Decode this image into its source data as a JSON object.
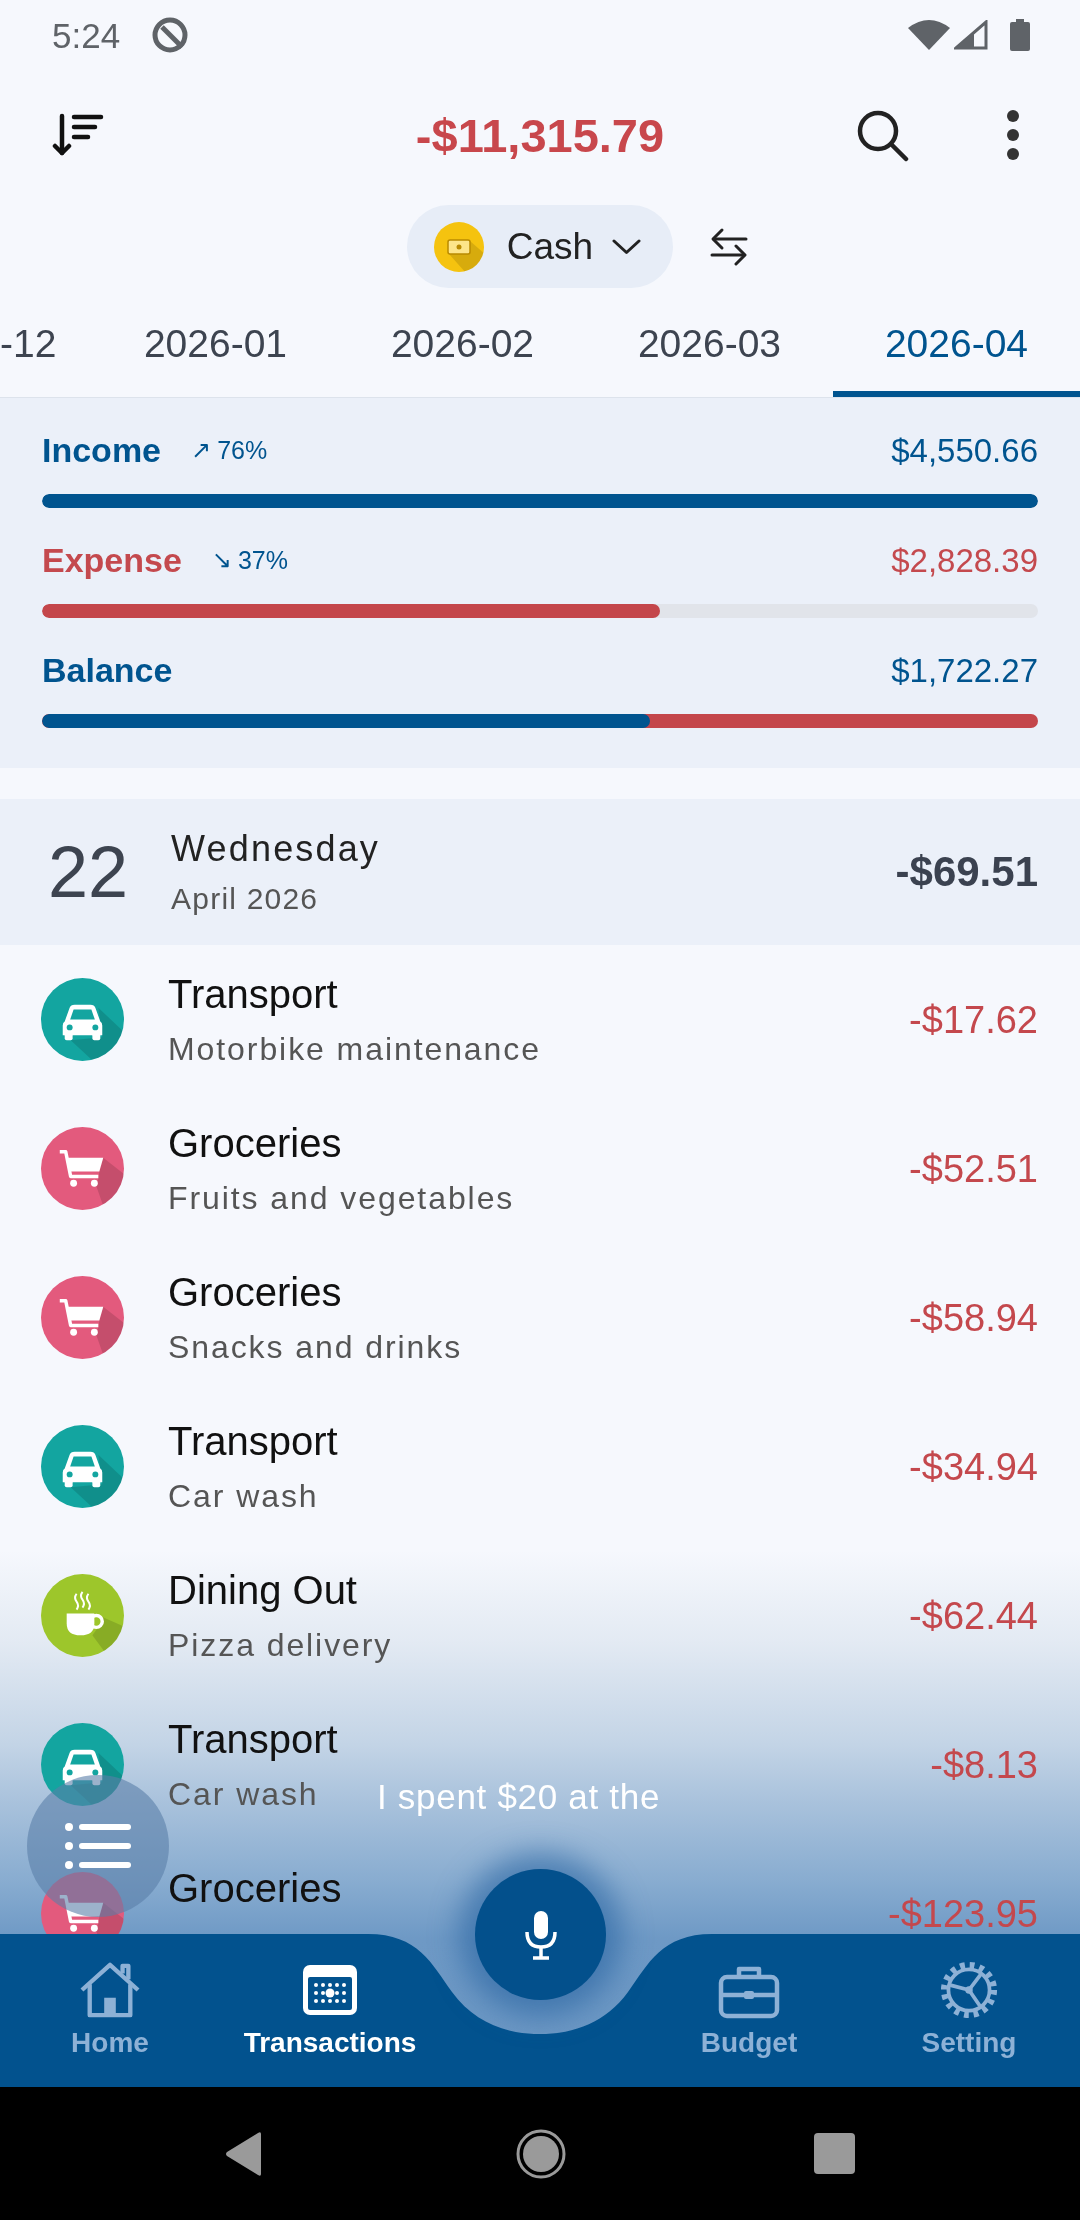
{
  "status_bar": {
    "time": "5:24"
  },
  "app_bar": {
    "total": "-$11,315.79"
  },
  "wallet_selector": {
    "label": "Cash"
  },
  "month_tabs": [
    {
      "label": "-12",
      "selected": false
    },
    {
      "label": "2026-01",
      "selected": false
    },
    {
      "label": "2026-02",
      "selected": false
    },
    {
      "label": "2026-03",
      "selected": false
    },
    {
      "label": "2026-04",
      "selected": true
    }
  ],
  "summary": [
    {
      "kind": "income",
      "label": "Income",
      "arrow": "↗",
      "change": "76%",
      "amount": "$4,550.66",
      "level": 1
    },
    {
      "kind": "expense",
      "label": "Expense",
      "arrow": "↘",
      "change": "37%",
      "amount": "$2,828.39",
      "level": 0.62
    },
    {
      "kind": "balance",
      "label": "Balance",
      "amount": "$1,722.27",
      "level": 0.61
    }
  ],
  "day": {
    "date": "22",
    "weekday": "Wednesday",
    "month": "April 2026",
    "total": "-$69.51"
  },
  "transactions": [
    {
      "kind": "transport",
      "color": "#13a5a0",
      "category": "Transport",
      "note": "Motorbike maintenance",
      "amount": "-$17.62"
    },
    {
      "kind": "groceries",
      "color": "#e35a7d",
      "category": "Groceries",
      "note": "Fruits and vegetables",
      "amount": "-$52.51"
    },
    {
      "kind": "groceries",
      "color": "#e35a7d",
      "category": "Groceries",
      "note": "Snacks and drinks",
      "amount": "-$58.94"
    },
    {
      "kind": "transport",
      "color": "#13a5a0",
      "category": "Transport",
      "note": "Car wash",
      "amount": "-$34.94"
    },
    {
      "kind": "dining",
      "color": "#9dc62b",
      "category": "Dining Out",
      "note": "Pizza delivery",
      "amount": "-$62.44"
    },
    {
      "kind": "transport",
      "color": "#13a5a0",
      "category": "Transport",
      "note": "Car wash",
      "amount": "-$8.13"
    },
    {
      "kind": "groceries",
      "color": "#e35a7d",
      "category": "Groceries",
      "amount": "-$123.95"
    }
  ],
  "voice_input": {
    "transcript": "I spent $20 at the"
  },
  "bottom_nav": [
    {
      "kind": "home",
      "label": "Home",
      "selected": false
    },
    {
      "kind": "transactions",
      "label": "Transactions",
      "selected": true
    },
    {
      "kind": "budget",
      "label": "Budget",
      "selected": false
    },
    {
      "kind": "setting",
      "label": "Setting",
      "selected": false
    }
  ]
}
